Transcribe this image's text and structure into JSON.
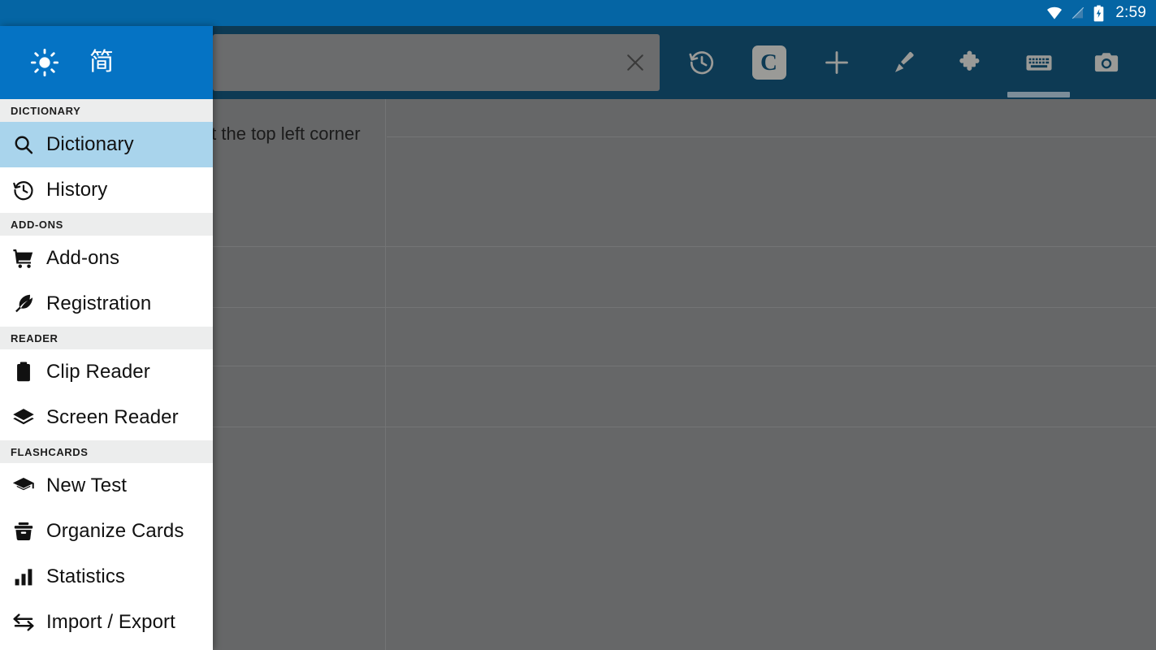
{
  "statusbar": {
    "time": "2:59",
    "icons": [
      "wifi-icon",
      "signal-off-icon",
      "battery-charging-icon"
    ]
  },
  "toolbar": {
    "search": {
      "value": "",
      "placeholder": ""
    },
    "clear_label": "✕",
    "actions": [
      {
        "name": "history-icon",
        "label": "History",
        "selected": false
      },
      {
        "name": "cedict-icon",
        "label": "C",
        "selected": false
      },
      {
        "name": "plus-icon",
        "label": "Add",
        "selected": false
      },
      {
        "name": "brush-icon",
        "label": "Handwriting",
        "selected": false
      },
      {
        "name": "puzzle-icon",
        "label": "Add-ons",
        "selected": false
      },
      {
        "name": "keyboard-icon",
        "label": "Keyboard",
        "selected": true
      },
      {
        "name": "camera-icon",
        "label": "Camera",
        "selected": false
      }
    ]
  },
  "content": {
    "hint": "...t one of the options\n...at the top left corner of the\n...res."
  },
  "drawer": {
    "header": {
      "icon": "sun-icon",
      "label": "简"
    },
    "sections": [
      {
        "title": "DICTIONARY",
        "items": [
          {
            "label": "Dictionary",
            "icon": "search-icon",
            "active": true
          },
          {
            "label": "History",
            "icon": "history-icon",
            "active": false
          }
        ]
      },
      {
        "title": "ADD-ONS",
        "items": [
          {
            "label": "Add-ons",
            "icon": "cart-icon",
            "active": false
          },
          {
            "label": "Registration",
            "icon": "feather-icon",
            "active": false
          }
        ]
      },
      {
        "title": "READER",
        "items": [
          {
            "label": "Clip Reader",
            "icon": "clipboard-icon",
            "active": false
          },
          {
            "label": "Screen Reader",
            "icon": "layers-icon",
            "active": false
          }
        ]
      },
      {
        "title": "FLASHCARDS",
        "items": [
          {
            "label": "New Test",
            "icon": "graduation-cap-icon",
            "active": false
          },
          {
            "label": "Organize Cards",
            "icon": "card-box-icon",
            "active": false
          },
          {
            "label": "Statistics",
            "icon": "bar-chart-icon",
            "active": false
          },
          {
            "label": "Import / Export",
            "icon": "transfer-icon",
            "active": false
          }
        ]
      }
    ]
  },
  "colors": {
    "statusbar_bg": "#0565a4",
    "toolbar_bg": "#0d3a54",
    "drawer_header_bg": "#0573c4",
    "active_item_bg": "#a9d4ec",
    "scrim": "#666768",
    "section_header_bg": "#eceded"
  }
}
